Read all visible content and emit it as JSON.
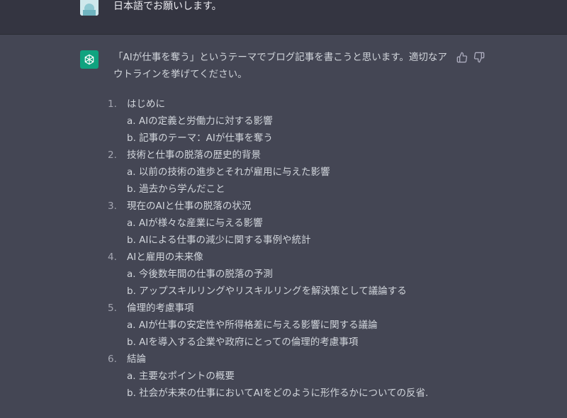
{
  "user_message": {
    "text": "日本語でお願いします。"
  },
  "assistant_message": {
    "intro": "「AIが仕事を奪う」というテーマでブログ記事を書こうと思います。適切なアウトラインを挙げてください。",
    "outline": [
      {
        "number": "1.",
        "title": "はじめに",
        "subs": [
          "a. AIの定義と労働力に対する影響",
          "b. 記事のテーマ：AIが仕事を奪う"
        ]
      },
      {
        "number": "2.",
        "title": "技術と仕事の脱落の歴史的背景",
        "subs": [
          "a. 以前の技術の進歩とそれが雇用に与えた影響",
          "b. 過去から学んだこと"
        ]
      },
      {
        "number": "3.",
        "title": "現在のAIと仕事の脱落の状況",
        "subs": [
          "a. AIが様々な産業に与える影響",
          "b. AIによる仕事の減少に関する事例や統計"
        ]
      },
      {
        "number": "4.",
        "title": "AIと雇用の未来像",
        "subs": [
          "a. 今後数年間の仕事の脱落の予測",
          "b. アップスキルリングやリスキルリングを解決策として議論する"
        ]
      },
      {
        "number": "5.",
        "title": "倫理的考慮事項",
        "subs": [
          "a. AIが仕事の安定性や所得格差に与える影響に関する議論",
          "b. AIを導入する企業や政府にとっての倫理的考慮事項"
        ]
      },
      {
        "number": "6.",
        "title": "結論",
        "subs": [
          "a. 主要なポイントの概要",
          "b. 社会が未来の仕事においてAIをどのように形作るかについての反省."
        ]
      }
    ]
  },
  "icons": {
    "assistant_avatar": "openai-logo-icon",
    "user_avatar": "user-avatar-icon",
    "thumb_up": "thumbs-up-icon",
    "thumb_down": "thumbs-down-icon"
  },
  "colors": {
    "user_row_bg": "#343541",
    "assistant_row_bg": "#444654",
    "assistant_avatar_bg": "#10a37f",
    "text": "#d1d5db"
  }
}
